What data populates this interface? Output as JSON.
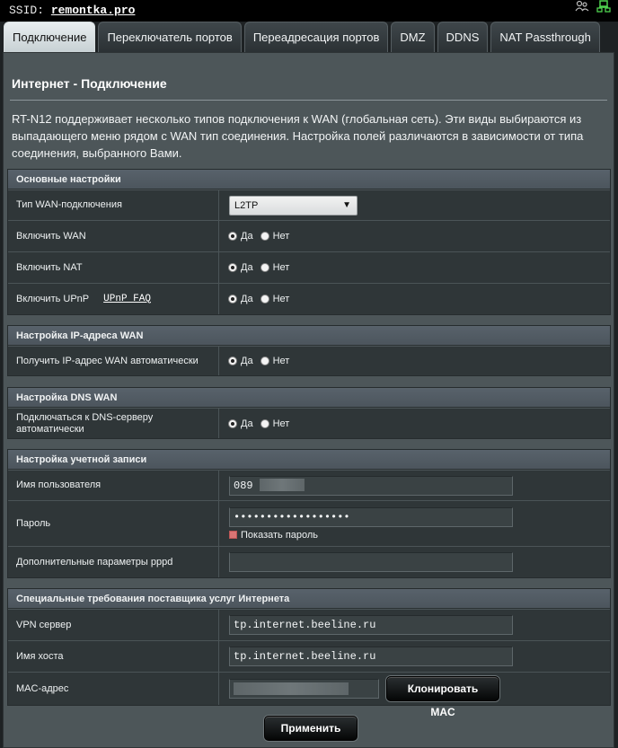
{
  "topbar": {
    "ssid_label": "SSID:",
    "ssid_value": "remontka.pro"
  },
  "tabs": [
    {
      "label": "Подключение",
      "active": true
    },
    {
      "label": "Переключатель портов",
      "active": false
    },
    {
      "label": "Переадресация портов",
      "active": false
    },
    {
      "label": "DMZ",
      "active": false
    },
    {
      "label": "DDNS",
      "active": false
    },
    {
      "label": "NAT Passthrough",
      "active": false
    }
  ],
  "page": {
    "title": "Интернет - Подключение",
    "description": "RT-N12 поддерживает несколько типов подключения к WAN (глобальная сеть). Эти виды выбираются из выпадающего меню рядом с WAN тип соединения. Настройка полей различаются в зависимости от типа соединения, выбранного Вами."
  },
  "radio_labels": {
    "yes": "Да",
    "no": "Нет"
  },
  "basic": {
    "header": "Основные настройки",
    "wan_type_label": "Тип WAN-подключения",
    "wan_type_value": "L2TP",
    "enable_wan_label": "Включить WAN",
    "enable_nat_label": "Включить NAT",
    "enable_upnp_label": "Включить UPnP",
    "upnp_faq_link": "UPnP  FAQ"
  },
  "wan_ip": {
    "header": "Настройка IP-адреса WAN",
    "auto_ip_label": "Получить IP-адрес WAN автоматически"
  },
  "wan_dns": {
    "header": "Настройка DNS WAN",
    "auto_dns_label": "Подключаться к DNS-серверу автоматически"
  },
  "account": {
    "header": "Настройка учетной записи",
    "username_label": "Имя пользователя",
    "username_value": "089",
    "password_label": "Пароль",
    "password_value": "••••••••••••••••••",
    "show_password_label": "Показать пароль",
    "pppd_label": "Дополнительные параметры pppd",
    "pppd_value": ""
  },
  "isp": {
    "header": "Специальные требования поставщика услуг Интернета",
    "vpn_label": "VPN сервер",
    "vpn_value": "tp.internet.beeline.ru",
    "host_label": "Имя хоста",
    "host_value": "tp.internet.beeline.ru",
    "mac_label": "MAC-адрес",
    "clone_mac_button": "Клонировать MAC"
  },
  "apply_button": "Применить",
  "colors": {
    "background": "#1e2224",
    "panel": "#4d5659",
    "row": "#2f3638",
    "active_tab": "#e9eef0"
  }
}
